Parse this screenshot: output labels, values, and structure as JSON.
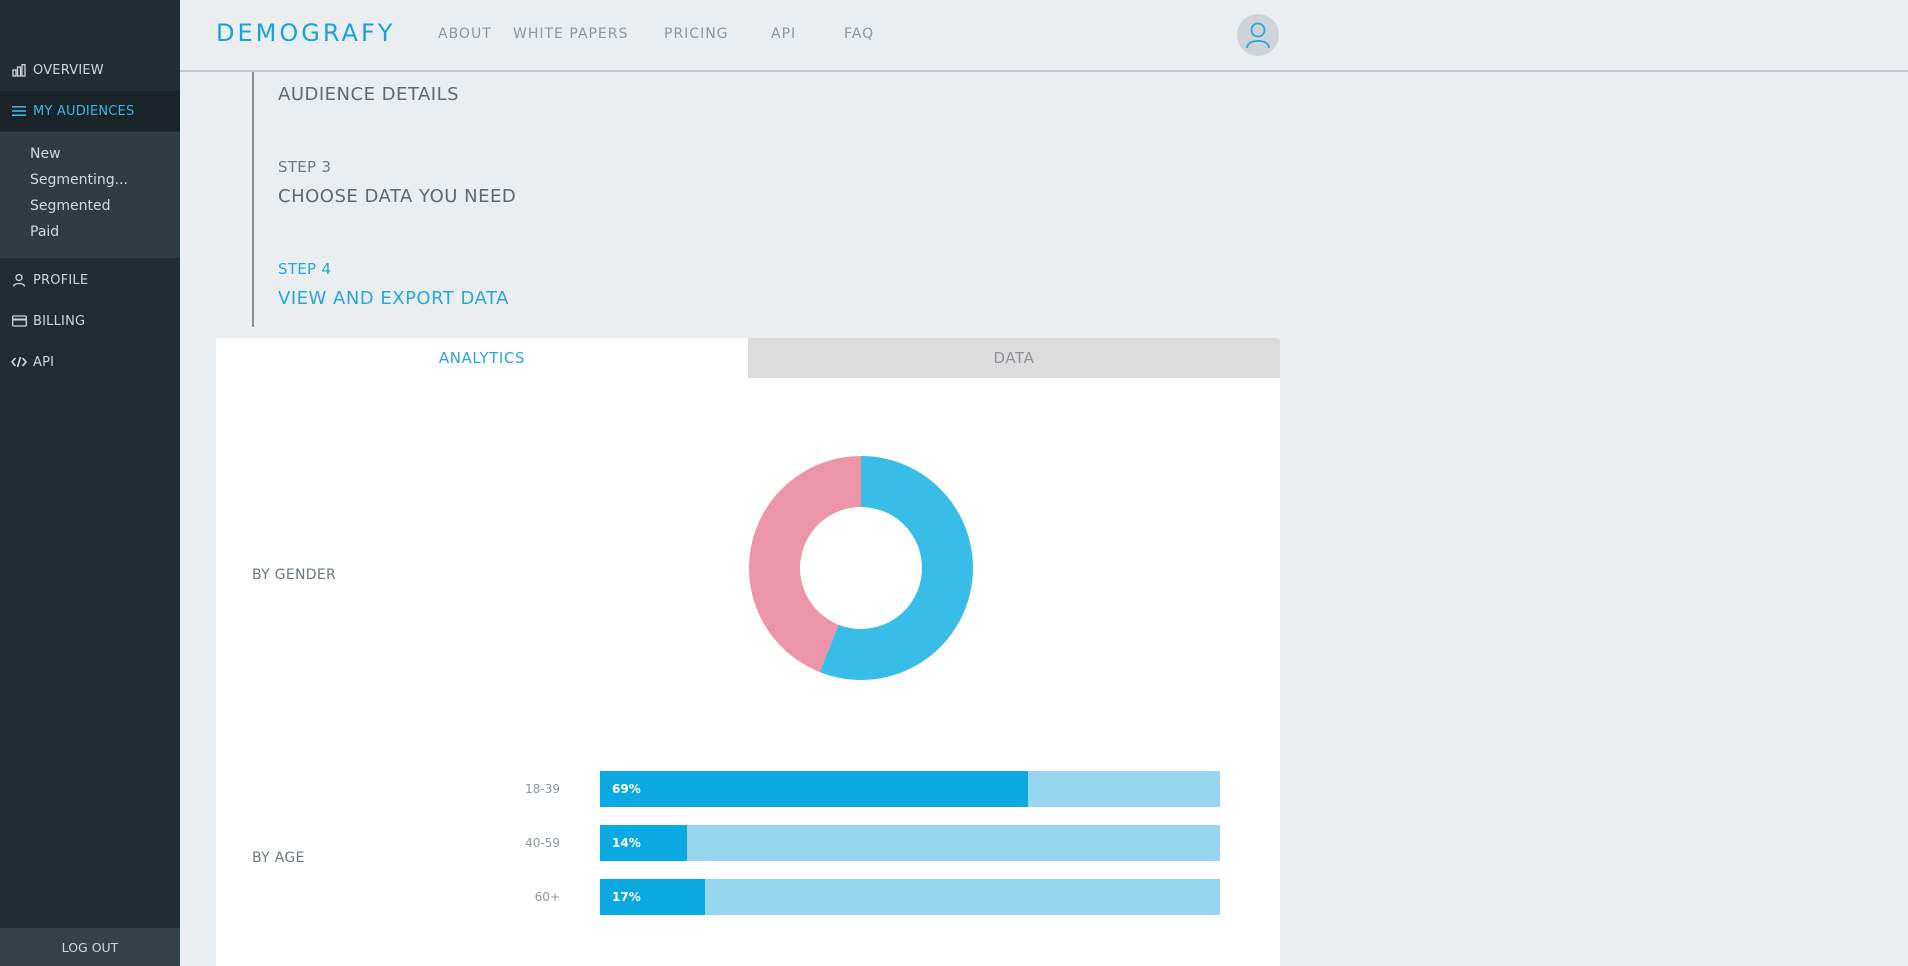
{
  "sidebar": {
    "items": [
      {
        "label": "OVERVIEW",
        "icon": "bar-chart-icon"
      },
      {
        "label": "MY AUDIENCES",
        "icon": "menu-icon"
      },
      {
        "label": "PROFILE",
        "icon": "user-icon"
      },
      {
        "label": "BILLING",
        "icon": "credit-card-icon"
      },
      {
        "label": "API",
        "icon": "code-icon"
      }
    ],
    "sub_items": [
      "New",
      "Segmenting...",
      "Segmented",
      "Paid"
    ],
    "logout": "LOG OUT"
  },
  "header": {
    "logo": "DEMOGRAFY",
    "nav": [
      "ABOUT",
      "WHITE PAPERS",
      "PRICING",
      "API",
      "FAQ"
    ]
  },
  "steps": [
    {
      "small": "",
      "big": "AUDIENCE DETAILS"
    },
    {
      "small": "STEP 3",
      "big": "CHOOSE DATA YOU NEED"
    },
    {
      "small": "STEP 4",
      "big": "VIEW AND EXPORT DATA"
    }
  ],
  "tabs": {
    "analytics": "ANALYTICS",
    "data": "DATA"
  },
  "analytics": {
    "gender_label": "BY GENDER",
    "age_label": "BY AGE"
  },
  "chart_data": [
    {
      "type": "pie",
      "title": "BY GENDER",
      "slices": [
        {
          "value": 56,
          "color": "#37bde8"
        },
        {
          "value": 44,
          "color": "#ec95a8"
        }
      ]
    },
    {
      "type": "bar",
      "title": "BY AGE",
      "categories": [
        "18-39",
        "40-59",
        "60+"
      ],
      "values": [
        69,
        14,
        17
      ],
      "labels": [
        "69%",
        "14%",
        "17%"
      ],
      "ylim": [
        0,
        100
      ],
      "colors": {
        "fill": "#0aa9e2",
        "track": "#96d7ef"
      }
    }
  ],
  "colors": {
    "accent": "#27a6dc",
    "sidebar": "#222d33",
    "background": "#ebeef1"
  }
}
